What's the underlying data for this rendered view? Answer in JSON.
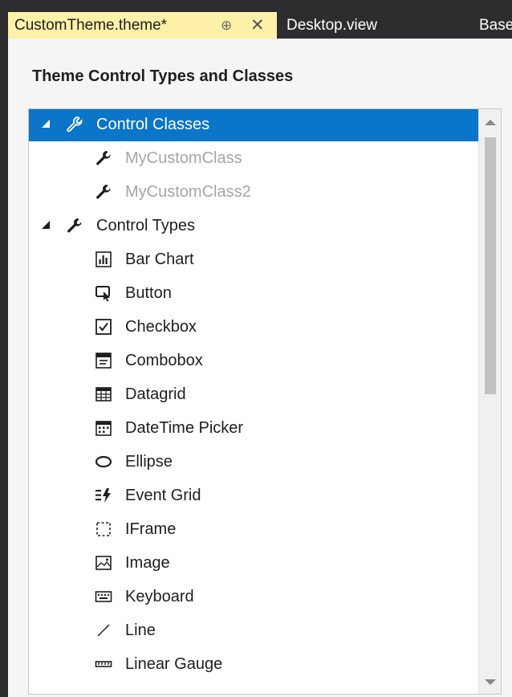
{
  "tabs": {
    "active_label": "CustomTheme.theme*",
    "pin_glyph": "⊕",
    "close_glyph": "✕",
    "desktop_label": "Desktop.view",
    "base_label": "Base"
  },
  "panel": {
    "heading": "Theme Control Types and Classes"
  },
  "tree": {
    "control_classes": {
      "label": "Control Classes",
      "items": [
        "MyCustomClass",
        "MyCustomClass2"
      ]
    },
    "control_types": {
      "label": "Control Types",
      "items": [
        {
          "label": "Bar Chart",
          "icon": "bar-chart-icon"
        },
        {
          "label": "Button",
          "icon": "button-icon"
        },
        {
          "label": "Checkbox",
          "icon": "checkbox-icon"
        },
        {
          "label": "Combobox",
          "icon": "combobox-icon"
        },
        {
          "label": "Datagrid",
          "icon": "datagrid-icon"
        },
        {
          "label": "DateTime Picker",
          "icon": "calendar-icon"
        },
        {
          "label": "Ellipse",
          "icon": "ellipse-icon"
        },
        {
          "label": "Event Grid",
          "icon": "event-grid-icon"
        },
        {
          "label": "IFrame",
          "icon": "iframe-icon"
        },
        {
          "label": "Image",
          "icon": "image-icon"
        },
        {
          "label": "Keyboard",
          "icon": "keyboard-icon"
        },
        {
          "label": "Line",
          "icon": "line-icon"
        },
        {
          "label": "Linear Gauge",
          "icon": "linear-gauge-icon"
        }
      ]
    }
  },
  "colors": {
    "selection": "#0a75c9",
    "active_tab": "#fff1a8",
    "chrome": "#2d2d30"
  }
}
